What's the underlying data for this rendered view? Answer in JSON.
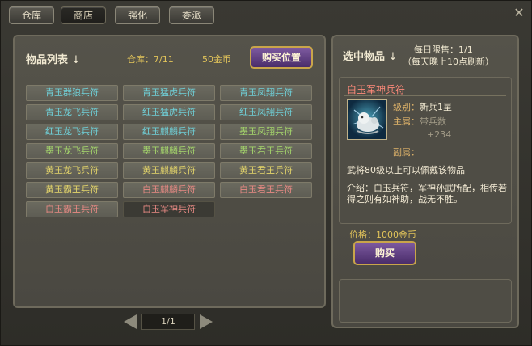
{
  "tabs": [
    {
      "label": "仓库",
      "active": false
    },
    {
      "label": "商店",
      "active": true
    },
    {
      "label": "强化",
      "active": false
    },
    {
      "label": "委派",
      "active": false
    }
  ],
  "close_icon": "close-x-icon",
  "list": {
    "title": "物品列表",
    "title_arrow": "↓",
    "warehouse": "仓库：7/11",
    "coins": "50金币",
    "buy_slot_label": "购买位置",
    "items": [
      {
        "name": "青玉群狼兵符",
        "color": "teal"
      },
      {
        "name": "青玉猛虎兵符",
        "color": "teal"
      },
      {
        "name": "青玉凤翔兵符",
        "color": "teal"
      },
      {
        "name": "青玉龙飞兵符",
        "color": "teal"
      },
      {
        "name": "红玉猛虎兵符",
        "color": "teal"
      },
      {
        "name": "红玉凤翔兵符",
        "color": "teal"
      },
      {
        "name": "红玉龙飞兵符",
        "color": "teal"
      },
      {
        "name": "红玉麒麟兵符",
        "color": "teal"
      },
      {
        "name": "墨玉凤翔兵符",
        "color": "green"
      },
      {
        "name": "墨玉龙飞兵符",
        "color": "green"
      },
      {
        "name": "墨玉麒麟兵符",
        "color": "green"
      },
      {
        "name": "墨玉君王兵符",
        "color": "green"
      },
      {
        "name": "黄玉龙飞兵符",
        "color": "yellow"
      },
      {
        "name": "黄玉麒麟兵符",
        "color": "yellow"
      },
      {
        "name": "黄玉君王兵符",
        "color": "yellow"
      },
      {
        "name": "黄玉霸王兵符",
        "color": "yellow"
      },
      {
        "name": "白玉麒麟兵符",
        "color": "pink"
      },
      {
        "name": "白玉君王兵符",
        "color": "pink"
      },
      {
        "name": "白玉霸王兵符",
        "color": "pink"
      },
      {
        "name": "白玉军神兵符",
        "color": "pink",
        "selected": true
      }
    ],
    "page": "1/1"
  },
  "selected": {
    "title": "选中物品",
    "title_arrow": "↓",
    "daily_limit": "每日限售：1/1",
    "refresh_note": "（每天晚上10点刷新）",
    "name": "白玉军神兵符",
    "level_label": "级别：",
    "level_value": "新兵1星",
    "main_label": "主属：",
    "main_value": "带兵数",
    "main_bonus": "+234",
    "sub_label": "副属：",
    "requirement": "武将80级以上可以佩戴该物品",
    "intro": "介绍：白玉兵符，军神孙武所配，相传若得之则有如神助，战无不胜。",
    "price": "价格：1000金币",
    "buy_label": "购买"
  }
}
